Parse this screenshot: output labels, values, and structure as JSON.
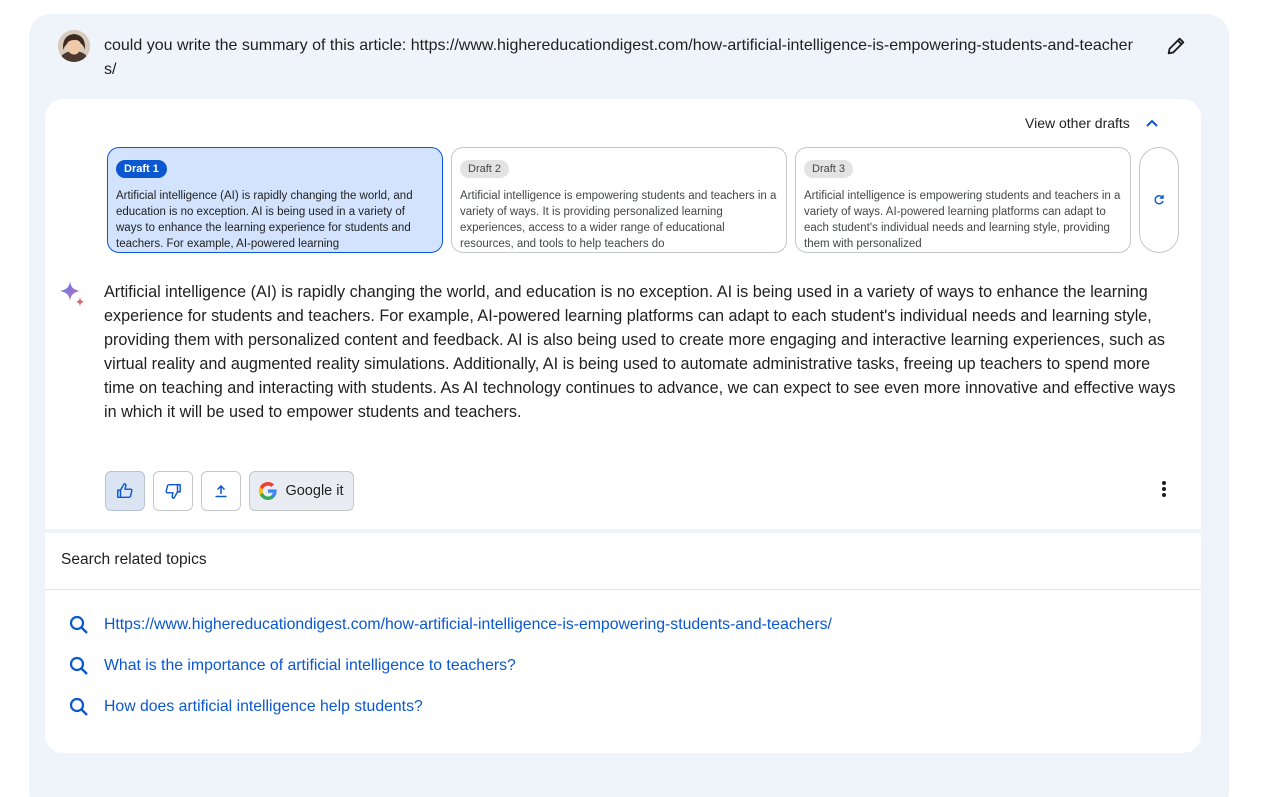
{
  "prompt": {
    "text": "could you write the summary of this article: https://www.highereducationdigest.com/how-artificial-intelligence-is-empowering-students-and-teachers/"
  },
  "drafts_header": {
    "label": "View other drafts"
  },
  "drafts": [
    {
      "badge": "Draft 1",
      "preview": "Artificial intelligence (AI) is rapidly changing the world, and education is no exception. AI is being used in a variety of ways to enhance the learning experience for students and teachers. For example, AI-powered learning",
      "selected": true
    },
    {
      "badge": "Draft 2",
      "preview": "Artificial intelligence is empowering students and teachers in a variety of ways. It is providing personalized learning experiences, access to a wider range of educational resources, and tools to help teachers do",
      "selected": false
    },
    {
      "badge": "Draft 3",
      "preview": "Artificial intelligence is empowering students and teachers in a variety of ways. AI-powered learning platforms can adapt to each student's individual needs and learning style, providing them with personalized",
      "selected": false
    }
  ],
  "answer": {
    "text": "Artificial intelligence (AI) is rapidly changing the world, and education is no exception. AI is being used in a variety of ways to enhance the learning experience for students and teachers. For example, AI-powered learning platforms can adapt to each student's individual needs and learning style, providing them with personalized content and feedback. AI is also being used to create more engaging and interactive learning experiences, such as virtual reality and augmented reality simulations. Additionally, AI is being used to automate administrative tasks, freeing up teachers to spend more time on teaching and interacting with students. As AI technology continues to advance, we can expect to see even more innovative and effective ways in which it will be used to empower students and teachers."
  },
  "actions": {
    "google_label": "Google it",
    "icons": [
      "thumbs-up-icon",
      "thumbs-down-icon",
      "share-icon",
      "google-icon",
      "more-vert-icon"
    ]
  },
  "related": {
    "title": "Search related topics",
    "items": [
      "Https://www.highereducationdigest.com/how-artificial-intelligence-is-empowering-students-and-teachers/",
      "What is the importance of artificial intelligence to teachers?",
      "How does artificial intelligence help students?"
    ]
  },
  "colors": {
    "background": "#eff3fa",
    "card": "#ffffff",
    "accent": "#0b57d0",
    "selected_draft": "#d3e3fd",
    "link": "#0b57d0"
  }
}
